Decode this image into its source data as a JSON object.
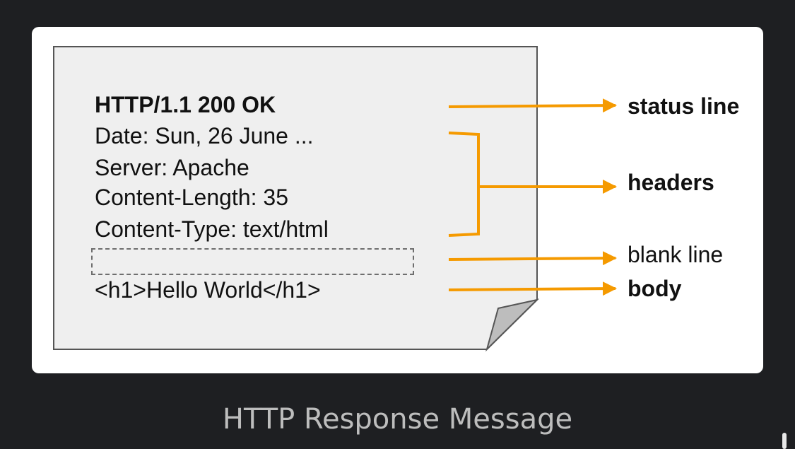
{
  "message": {
    "status_line": "HTTP/1.1 200 OK",
    "headers": [
      "Date: Sun, 26 June ...",
      "Server: Apache",
      "Content-Length: 35",
      "Content-Type: text/html"
    ],
    "body": "<h1>Hello World</h1>"
  },
  "labels": {
    "status_line": "status line",
    "headers": "headers",
    "blank_line": "blank line",
    "body": "body"
  },
  "caption": "HTTP Response Message",
  "colors": {
    "page_background": "#1e1f22",
    "card_background": "#ffffff",
    "document_fill": "#efefef",
    "arrow": "#f59a00",
    "caption_text": "#bdbdbd"
  }
}
